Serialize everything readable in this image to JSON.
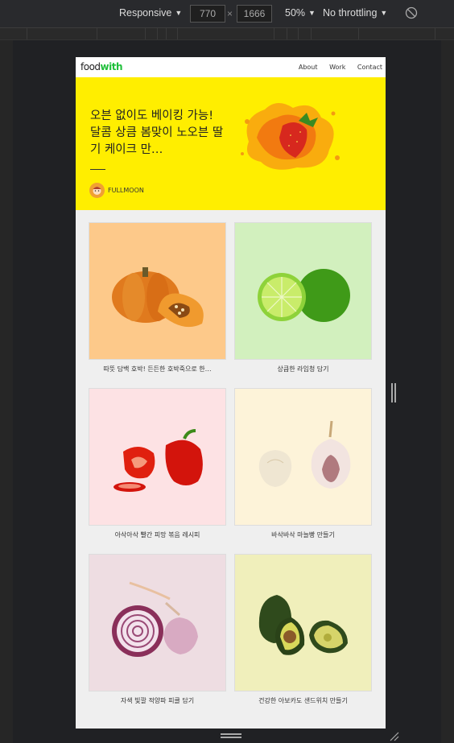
{
  "devtools": {
    "device_label": "Responsive",
    "width_value": "770",
    "height_value": "1666",
    "times_symbol": "×",
    "zoom_label": "50%",
    "throttle_label": "No throttling"
  },
  "site": {
    "logo_part1": "food",
    "logo_part2": "with",
    "nav": [
      "About",
      "Work",
      "Contact"
    ]
  },
  "hero": {
    "title": "오븐 없이도 베이킹 가능! 달콤 상큼 봄맞이 노오븐 딸기 케이크 만…",
    "author": "FULLMOON"
  },
  "cards": [
    {
      "caption": "따뜻 담백 호박! 든든한 호박죽으로 한…",
      "bg": "#fdc98a",
      "icon": "pumpkin-image"
    },
    {
      "caption": "상큼한 라임청 담기",
      "bg": "#d2f0be",
      "icon": "lime-image"
    },
    {
      "caption": "아삭아삭 빨간 피망 볶음 레시피",
      "bg": "#fde2e4",
      "icon": "red-pepper-image"
    },
    {
      "caption": "바삭바삭 마늘빵 만들기",
      "bg": "#fdf3d9",
      "icon": "garlic-image"
    },
    {
      "caption": "자색 빛깔 적양파 피클 담기",
      "bg": "#eedde2",
      "icon": "red-onion-image"
    },
    {
      "caption": "건강한 아보카도 샌드위치 만들기",
      "bg": "#f0efbb",
      "icon": "avocado-image"
    }
  ]
}
